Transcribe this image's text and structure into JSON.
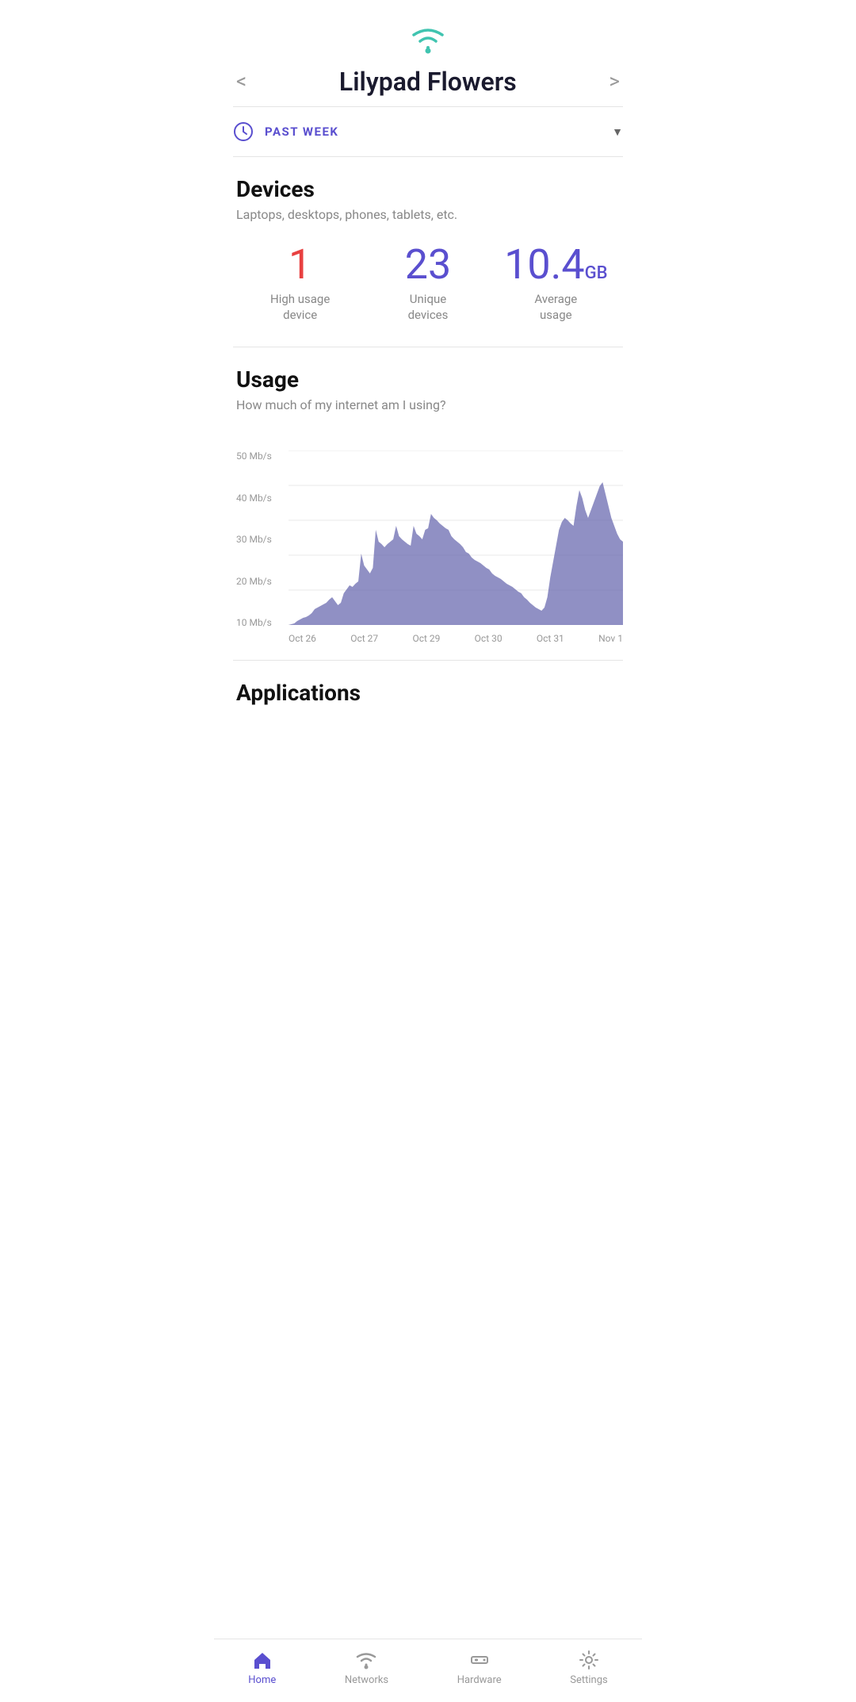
{
  "header": {
    "wifi_icon_label": "wifi-icon",
    "title": "Lilypad Flowers",
    "nav_left": "<",
    "nav_right": ">"
  },
  "period": {
    "label": "PAST WEEK",
    "dropdown_arrow": "▼"
  },
  "devices": {
    "section_title": "Devices",
    "section_subtitle": "Laptops, desktops, phones, tablets, etc.",
    "stats": [
      {
        "value": "1",
        "label": "High usage\ndevice",
        "color": "red",
        "unit": ""
      },
      {
        "value": "23",
        "label": "Unique\ndevices",
        "color": "purple",
        "unit": ""
      },
      {
        "value": "10.4",
        "label": "Average\nusage",
        "color": "purple",
        "unit": "GB"
      }
    ]
  },
  "usage": {
    "section_title": "Usage",
    "section_subtitle": "How much of my internet am I using?",
    "y_labels": [
      "50 Mb/s",
      "40 Mb/s",
      "30 Mb/s",
      "20 Mb/s",
      "10 Mb/s"
    ],
    "x_labels": [
      "Oct 26",
      "Oct 27",
      "Oct 29",
      "Oct 30",
      "Oct 31",
      "Nov 1"
    ]
  },
  "applications": {
    "section_title": "Applications"
  },
  "nav": {
    "items": [
      {
        "id": "home",
        "label": "Home",
        "active": true
      },
      {
        "id": "networks",
        "label": "Networks",
        "active": false
      },
      {
        "id": "hardware",
        "label": "Hardware",
        "active": false
      },
      {
        "id": "settings",
        "label": "Settings",
        "active": false
      }
    ]
  }
}
